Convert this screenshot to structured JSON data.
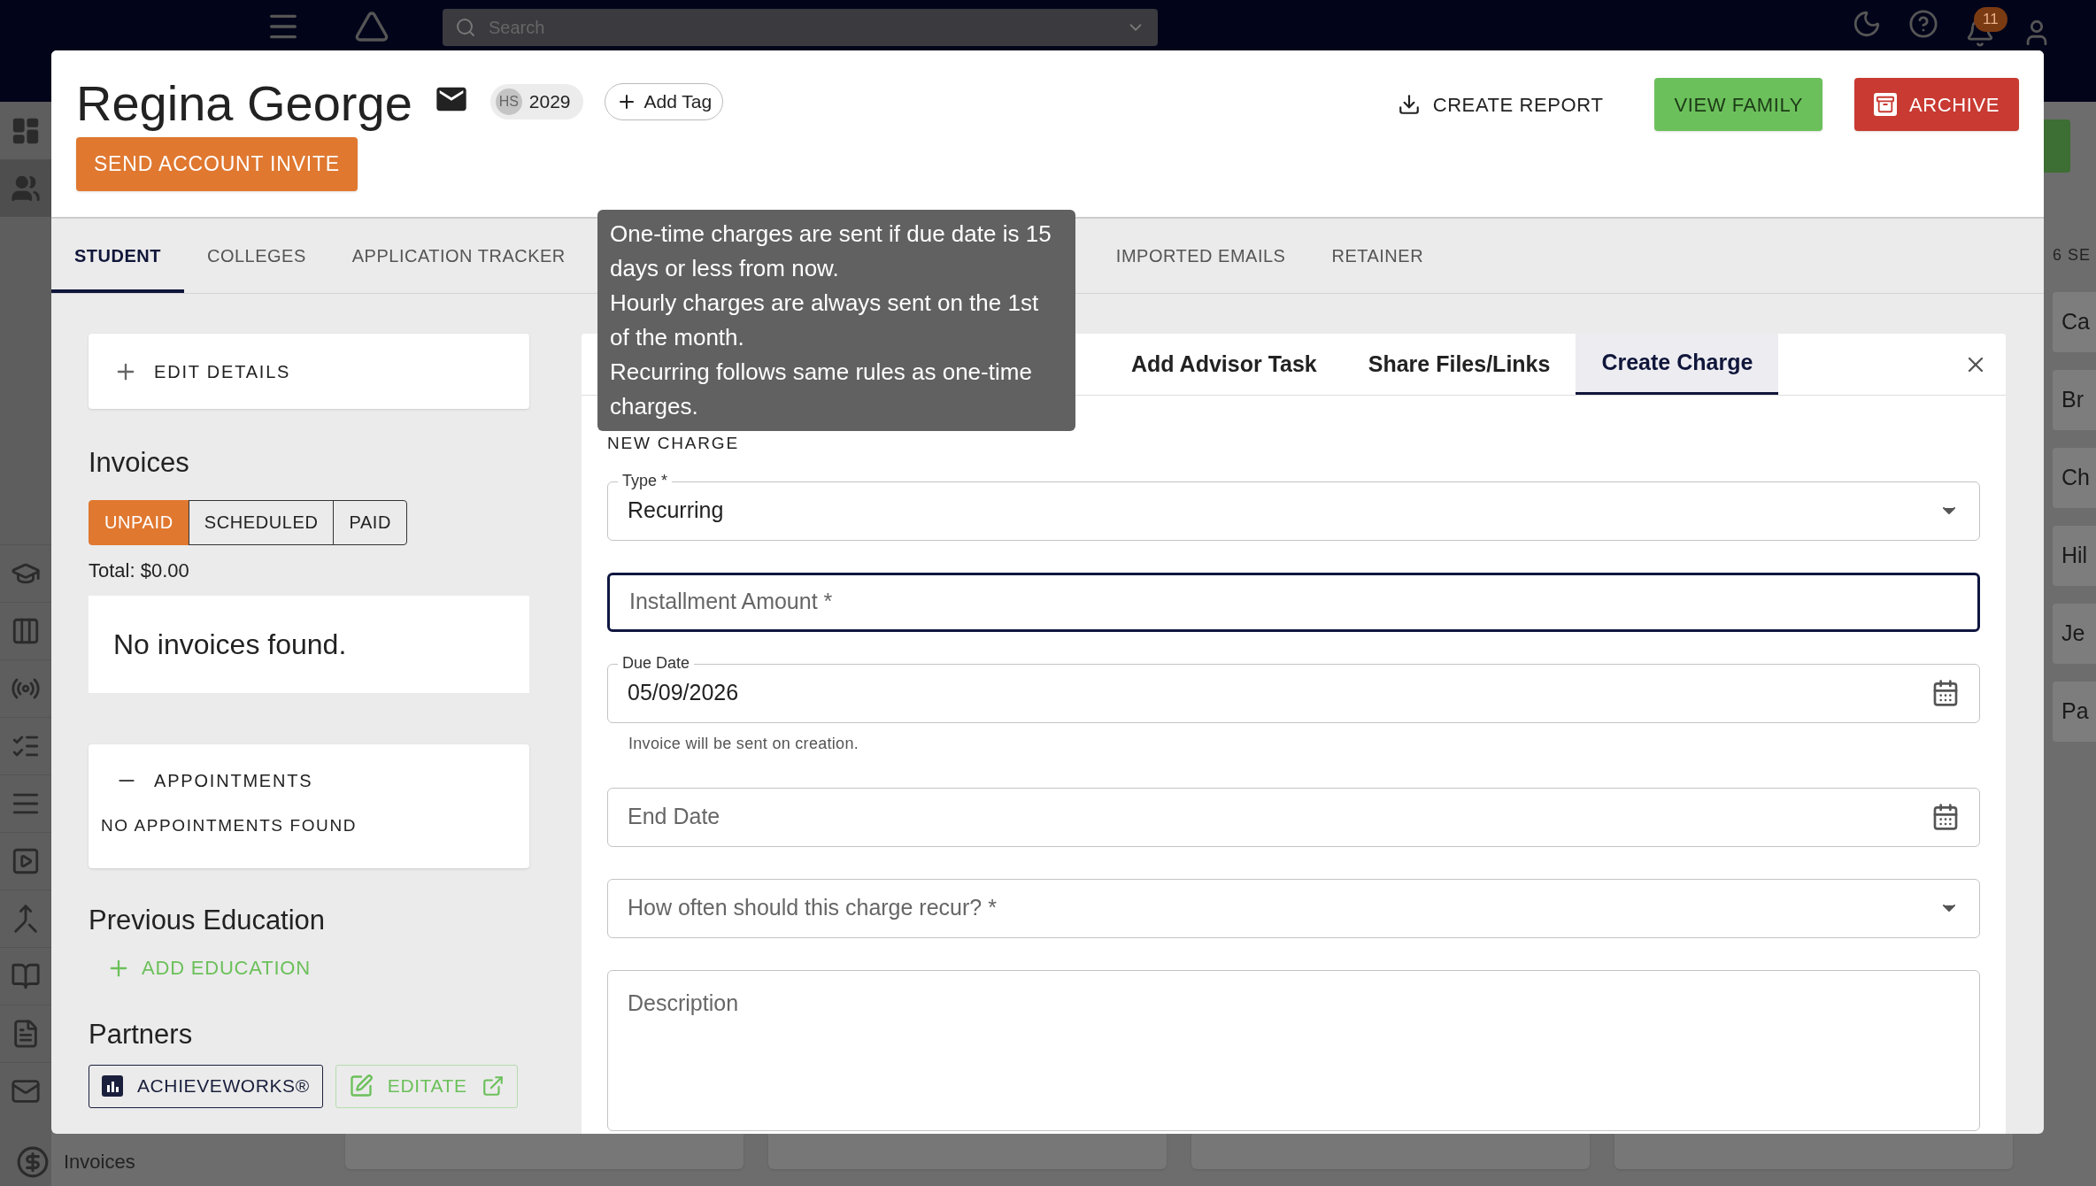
{
  "background": {
    "search": {
      "placeholder": "Search"
    },
    "notification_count": "11",
    "sidebar_items": [
      {
        "label": "Invoices"
      }
    ],
    "right_list": {
      "heading": "6 SE",
      "items": [
        "Ca",
        "Br",
        "Ch",
        "Hil",
        "Je",
        "Pa"
      ]
    }
  },
  "student": {
    "name": "Regina George",
    "chip": {
      "avatar": "HS",
      "label": "2029"
    },
    "add_tag": "Add Tag",
    "invite_button": "SEND ACCOUNT INVITE"
  },
  "actions": [
    {
      "kind": "text",
      "label": "CREATE REPORT"
    },
    {
      "kind": "green",
      "label": "VIEW FAMILY"
    },
    {
      "kind": "red",
      "label": "ARCHIVE"
    }
  ],
  "tabs": [
    {
      "label": "STUDENT",
      "selected": true
    },
    {
      "label": "COLLEGES",
      "selected": false
    },
    {
      "label": "APPLICATION TRACKER",
      "selected": false
    },
    {
      "label": "IMPORTED EMAILS",
      "selected": false
    },
    {
      "label": "RETAINER",
      "selected": false
    }
  ],
  "details_button": "EDIT DETAILS",
  "invoices": {
    "title": "Invoices",
    "filters": [
      {
        "label": "UNPAID",
        "selected": true
      },
      {
        "label": "SCHEDULED",
        "selected": false
      },
      {
        "label": "PAID",
        "selected": false
      }
    ],
    "total": "Total: $0.00",
    "empty": "No invoices found."
  },
  "appointments": {
    "title": "APPOINTMENTS",
    "expanded": true,
    "empty": "NO APPOINTMENTS FOUND"
  },
  "previous_education": {
    "title": "Previous Education",
    "add": "ADD EDUCATION"
  },
  "partners": {
    "title": "Partners",
    "links": [
      {
        "kind": "dark",
        "label": "ACHIEVEWORKS®"
      },
      {
        "kind": "green",
        "label": "EDITATE"
      }
    ]
  },
  "panel": {
    "tabs": [
      {
        "label": "Add Advisor Task",
        "selected": false
      },
      {
        "label": "Share Files/Links",
        "selected": false
      },
      {
        "label": "Create Charge",
        "selected": true
      }
    ],
    "section": "NEW CHARGE",
    "fields": [
      {
        "kind": "select",
        "label": "Type *",
        "value": "Recurring",
        "focused": false
      },
      {
        "kind": "text",
        "placeholder": "Installment Amount *",
        "focused": true
      },
      {
        "kind": "date",
        "label": "Due Date",
        "value": "05/09/2026",
        "helper": "Invoice will be sent on creation.",
        "focused": false
      },
      {
        "kind": "date",
        "placeholder": "End Date",
        "focused": false
      },
      {
        "kind": "select",
        "placeholder": "How often should this charge recur? *",
        "focused": false
      },
      {
        "kind": "textarea",
        "placeholder": "Description",
        "focused": false
      }
    ]
  },
  "tooltip": {
    "lines": [
      "One-time charges are sent if due date is 15 days or less from now.",
      "Hourly charges are always sent on the 1st of the month.",
      "Recurring follows same rules as one-time charges."
    ]
  }
}
